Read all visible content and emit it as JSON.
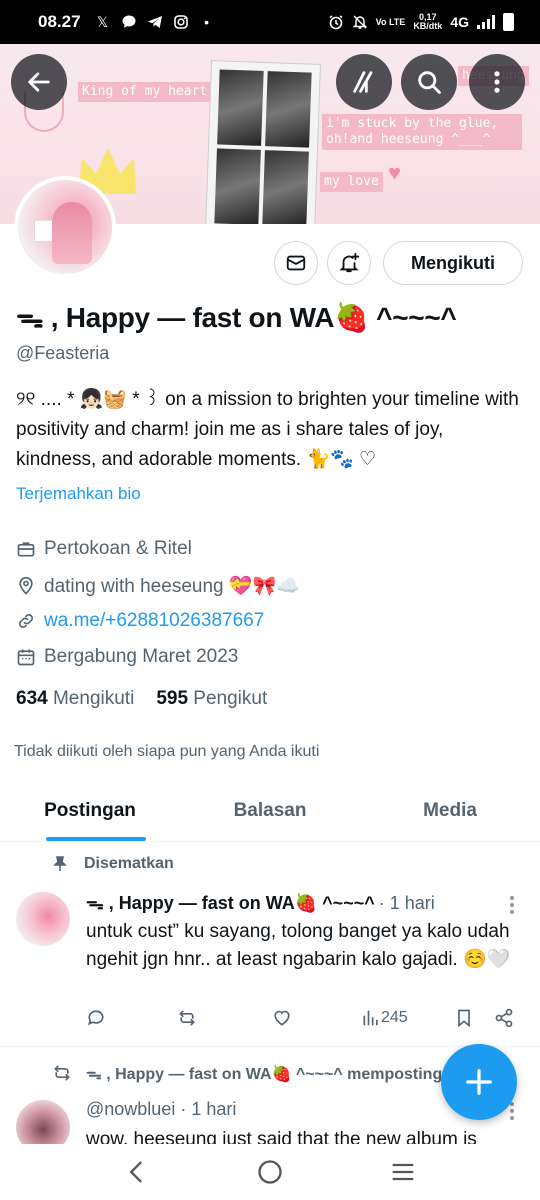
{
  "status_bar": {
    "time": "08.27",
    "network_speed_value": "0,17",
    "network_speed_unit": "KB/dtk",
    "volte": "Vo LTE",
    "network_type": "4G",
    "icons": [
      "x-logo-icon",
      "chat-icon",
      "telegram-icon",
      "instagram-icon",
      "dot-icon",
      "alarm-icon",
      "mute-icon",
      "signal-icon",
      "battery-icon"
    ]
  },
  "banner": {
    "text_king": "King of my heart",
    "text_stuck": "i'm stuck by the glue, oh!and heeseung ^___^",
    "text_love": "my love",
    "text_heeseung": "heeseung",
    "bg_color": "#fbe3ea"
  },
  "header_buttons": {
    "back": "back-arrow-icon",
    "grok": "grok-icon",
    "search": "search-icon",
    "more": "more-vertical-icon"
  },
  "profile": {
    "follow_button_label": "Mengikuti",
    "display_name": "ᯓ , Happy — fast on WA🍓 ^~~~^",
    "handle": "@Feasteria",
    "bio": "୨୧ .... * 👧🏻🧺 * ꒱ on a mission to brighten your timeline with positivity and charm! join me as i share tales of joy, kindness, and adorable moments. 🐈🐾 ♡",
    "translate_label": "Terjemahkan bio",
    "category": "Pertokoan & Ritel",
    "location": "dating with heeseung 💝🎀☁️",
    "link": "wa.me/+62881026387667",
    "joined": "Bergabung Maret 2023",
    "following_count": "634",
    "following_label": "Mengikuti",
    "followers_count": "595",
    "followers_label": "Pengikut",
    "not_followed_text": "Tidak diikuti oleh siapa pun yang Anda ikuti"
  },
  "tabs": [
    {
      "label": "Postingan",
      "active": true
    },
    {
      "label": "Balasan",
      "active": false
    },
    {
      "label": "Media",
      "active": false
    }
  ],
  "pinned_tweet": {
    "pinned_label": "Disematkan",
    "author_name": "ᯓ , Happy — fast on WA🍓 ^~~~^",
    "time": "· 1 hari",
    "text": "untuk cust” ku sayang, tolong banget ya kalo udah ngehit jgn hnr.. at least ngabarin kalo gajadi. ☺️🤍",
    "views": "245"
  },
  "second_tweet": {
    "retweet_label": "ᯓ , Happy — fast on WA🍓 ^~~~^ memposting ulang",
    "author_handle": "@nowbluei",
    "time": "· 1 hari",
    "text": "wow, heeseung just said that the new album is"
  },
  "accent_color": "#1d9bf0"
}
